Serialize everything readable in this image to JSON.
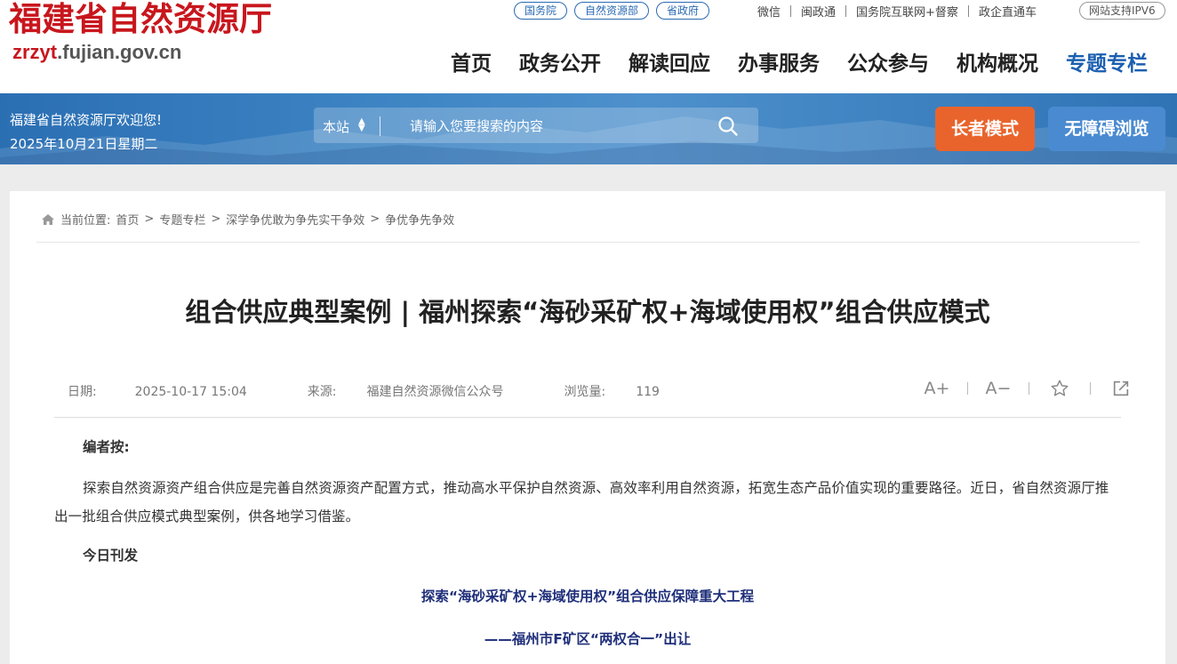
{
  "site": {
    "name_cn": "福建省自然资源厅",
    "domain_prefix": "zrzyt",
    "domain_rest": ".fujian.gov.cn",
    "brand_color": "#c8161d"
  },
  "top_pills": [
    "国务院",
    "自然资源部",
    "省政府"
  ],
  "top_links": [
    "微信",
    "闽政通",
    "国务院互联网+督察",
    "政企直通车"
  ],
  "ipv6_label": "网站支持IPV6",
  "nav": {
    "items": [
      "首页",
      "政务公开",
      "解读回应",
      "办事服务",
      "公众参与",
      "机构概况",
      "专题专栏"
    ],
    "active_index": 6,
    "active_color": "#1b5fb0"
  },
  "banner": {
    "welcome": "福建省自然资源厅欢迎您!",
    "date": "2025年10月21日星期二",
    "scope": "本站",
    "search_placeholder": "请输入您要搜索的内容",
    "elder_mode": "长者模式",
    "accessible": "无障碍浏览"
  },
  "breadcrumb": {
    "prefix": "当前位置:",
    "items": [
      "首页",
      "专题专栏",
      "深学争优敢为争先实干争效",
      "争优争先争效"
    ]
  },
  "article": {
    "title": "组合供应典型案例 | 福州探索“海砂采矿权+海域使用权”组合供应模式",
    "date_label": "日期:",
    "date": "2025-10-17 15:04",
    "source_label": "来源:",
    "source": "福建自然资源微信公众号",
    "views_label": "浏览量:",
    "views": "119",
    "tools": {
      "font_up": "A+",
      "font_down": "A−"
    },
    "editor_note": "编者按:",
    "paragraph": "探索自然资源资产组合供应是完善自然资源资产配置方式，推动高水平保护自然资源、高效率利用自然资源，拓宽生态产品价值实现的重要路径。近日，省自然资源厅推出一批组合供应模式典型案例，供各地学习借鉴。",
    "today_label": "今日刊发",
    "subtitle1": "探索“海砂采矿权+海域使用权”组合供应保障重大工程",
    "subtitle2": "——福州市F矿区“两权合一”出让",
    "subtitle_color": "#1f2f7a"
  }
}
